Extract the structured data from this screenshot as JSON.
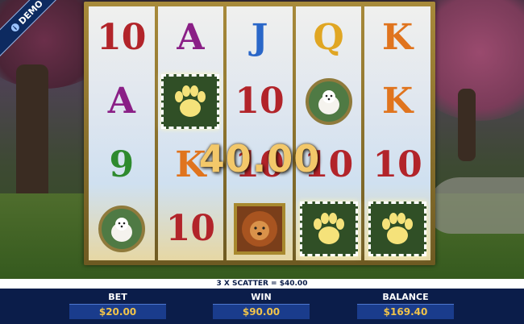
{
  "badge": {
    "label": "DEMO"
  },
  "reels": [
    [
      "10",
      "A",
      "9",
      "dog"
    ],
    [
      "A",
      "paw",
      "K",
      "10"
    ],
    [
      "J",
      "10",
      "10",
      "lion"
    ],
    [
      "Q",
      "dog",
      "10",
      "paw"
    ],
    [
      "K",
      "K",
      "10",
      "paw"
    ]
  ],
  "win_amount": "40.00",
  "message": "3 X SCATTER = $40.00",
  "meters": {
    "bet": {
      "label": "BET",
      "value": "$20.00"
    },
    "win": {
      "label": "WIN",
      "value": "$90.00"
    },
    "balance": {
      "label": "BALANCE",
      "value": "$169.40"
    }
  },
  "colors": {
    "panel": "#0b1d4a",
    "meter_value": "#f0c34a",
    "frame": "#a88a3a"
  },
  "icons": {
    "paw": "paw-scatter-icon",
    "dog": "maltese-dog-icon",
    "lion": "lion-icon"
  }
}
